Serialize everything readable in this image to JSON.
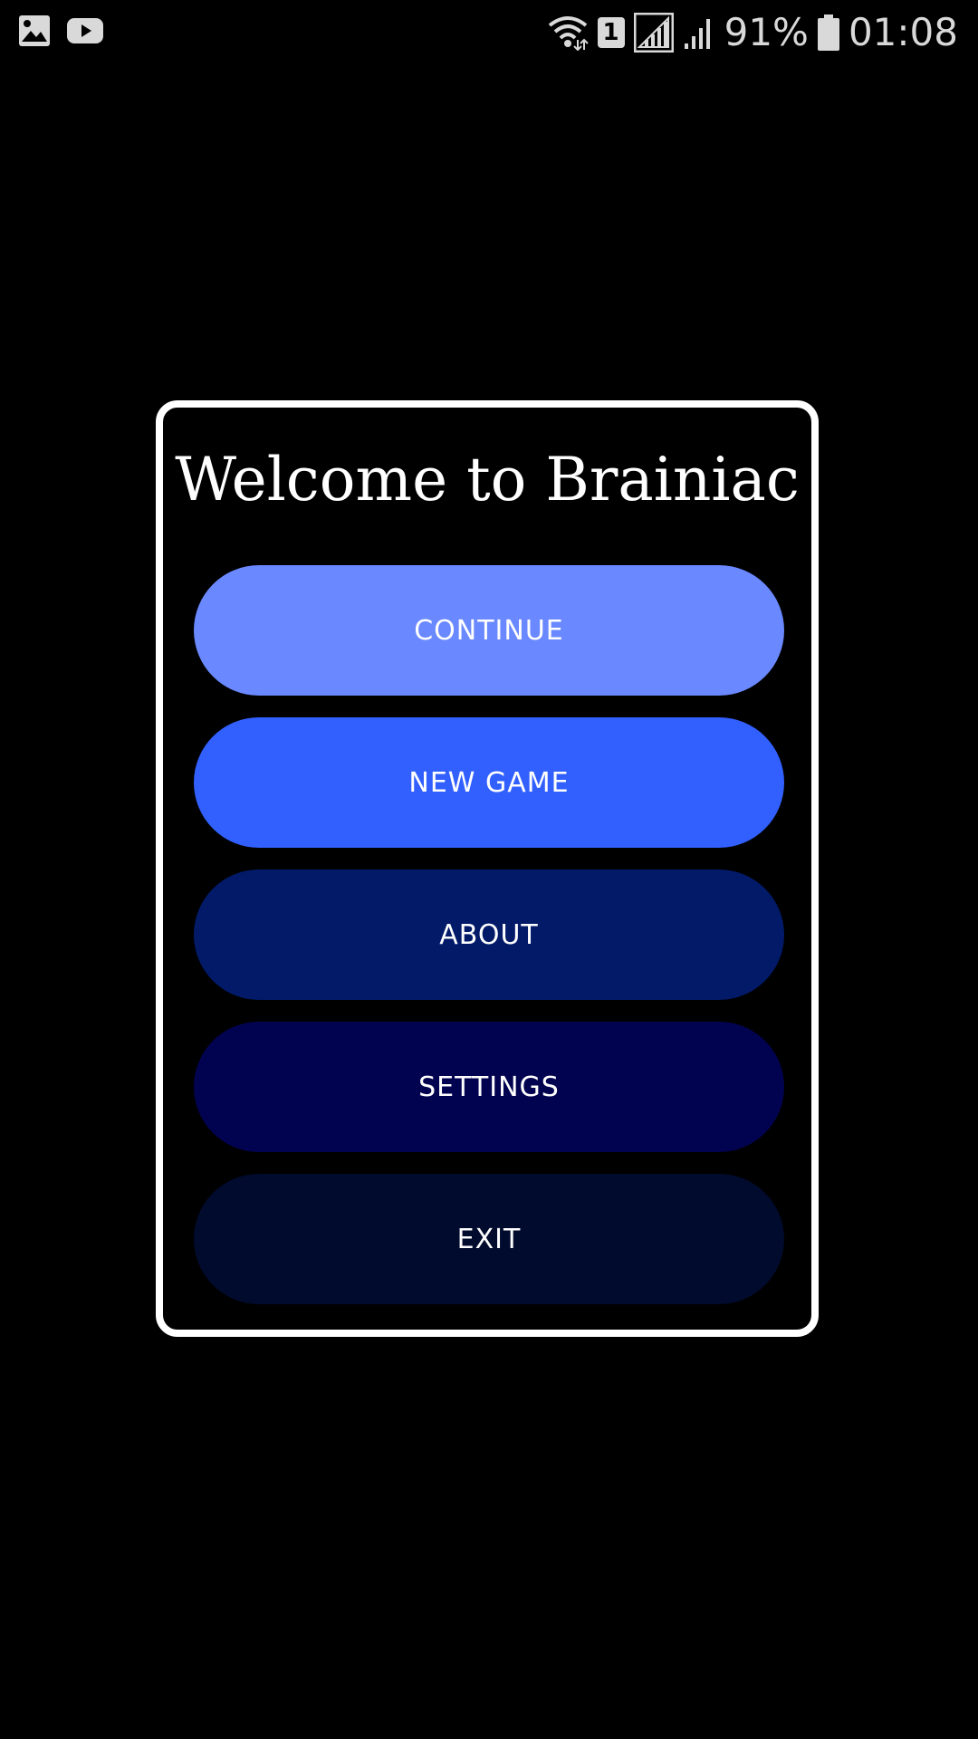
{
  "status_bar": {
    "left_icons": [
      "image-icon",
      "youtube-icon"
    ],
    "right_icons": [
      "wifi-icon",
      "sim-icon",
      "signal-icon",
      "signal-icon-2",
      "battery-icon"
    ],
    "sim_number": "1",
    "battery": "91%",
    "time": "01:08"
  },
  "dialog": {
    "title": "Welcome to Brainiac",
    "buttons": [
      {
        "label": "CONTINUE",
        "color": "#6a88ff"
      },
      {
        "label": "NEW GAME",
        "color": "#3160ff"
      },
      {
        "label": "ABOUT",
        "color": "#021a68"
      },
      {
        "label": "SETTINGS",
        "color": "#020350"
      },
      {
        "label": "EXIT",
        "color": "#010b2d"
      }
    ]
  },
  "colors": {
    "background": "#000000",
    "border": "#ffffff",
    "text": "#ffffff",
    "status_text": "#d9d9d9"
  }
}
